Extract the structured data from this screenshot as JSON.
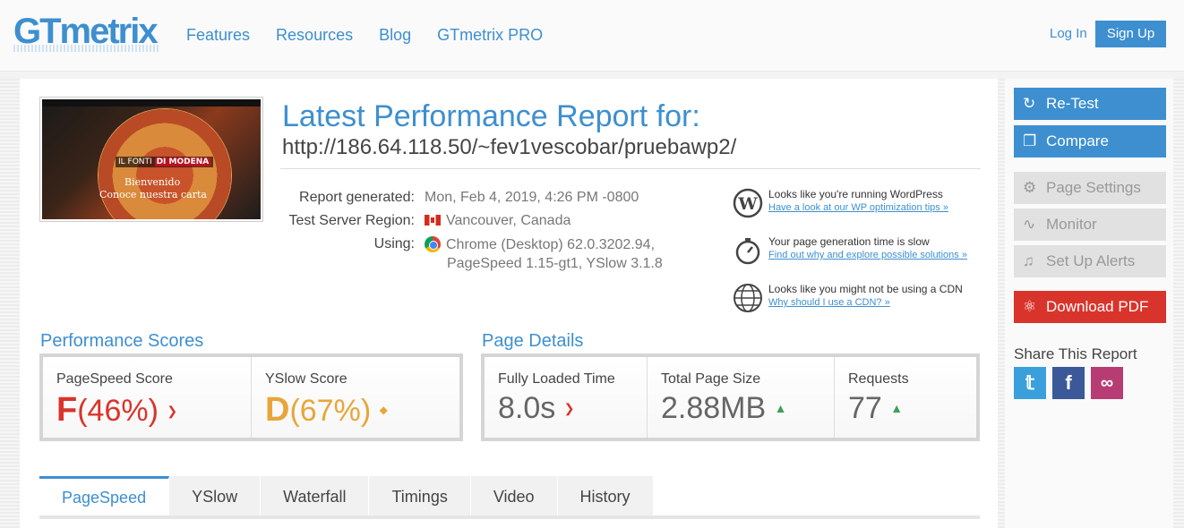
{
  "header": {
    "logo": "GTmetrix",
    "nav": [
      "Features",
      "Resources",
      "Blog",
      "GTmetrix PRO"
    ],
    "login": "Log In",
    "signup": "Sign Up"
  },
  "report": {
    "title": "Latest Performance Report for:",
    "url": "http://186.64.118.50/~fev1vescobar/pruebawp2/",
    "thumbnail": {
      "brand_a": "IL FONTI",
      "brand_b": "DI MODENA",
      "line1": "Bienvenido",
      "line2": "Conoce nuestra carta"
    },
    "generated_label": "Report generated:",
    "generated_value": "Mon, Feb 4, 2019, 4:26 PM -0800",
    "region_label": "Test Server Region:",
    "region_value": "Vancouver, Canada",
    "using_label": "Using:",
    "using_value1": "Chrome (Desktop) 62.0.3202.94,",
    "using_value2": "PageSpeed 1.15-gt1, YSlow 3.1.8"
  },
  "tips": [
    {
      "icon": "wordpress-icon",
      "text": "Looks like you're running WordPress",
      "link": "Have a look at our WP optimization tips »"
    },
    {
      "icon": "stopwatch-icon",
      "text": "Your page generation time is slow",
      "link": "Find out why and explore possible solutions »"
    },
    {
      "icon": "globe-icon",
      "text": "Looks like you might not be using a CDN",
      "link": "Why should I use a CDN? »"
    }
  ],
  "scores": {
    "title": "Performance Scores",
    "pagespeed_label": "PageSpeed Score",
    "pagespeed_grade": "F",
    "pagespeed_pct": "(46%)",
    "yslow_label": "YSlow Score",
    "yslow_grade": "D",
    "yslow_pct": "(67%)"
  },
  "details": {
    "title": "Page Details",
    "loaded_label": "Fully Loaded Time",
    "loaded_value": "8.0s",
    "size_label": "Total Page Size",
    "size_value": "2.88MB",
    "requests_label": "Requests",
    "requests_value": "77"
  },
  "tabs": [
    "PageSpeed",
    "YSlow",
    "Waterfall",
    "Timings",
    "Video",
    "History"
  ],
  "sidebar": {
    "retest": "Re-Test",
    "compare": "Compare",
    "settings": "Page Settings",
    "monitor": "Monitor",
    "alerts": "Set Up Alerts",
    "pdf": "Download PDF",
    "share_title": "Share This Report"
  },
  "colors": {
    "accent": "#3d8fd0",
    "bad": "#d9342b",
    "warn": "#e8a63a",
    "good": "#3aa356"
  }
}
